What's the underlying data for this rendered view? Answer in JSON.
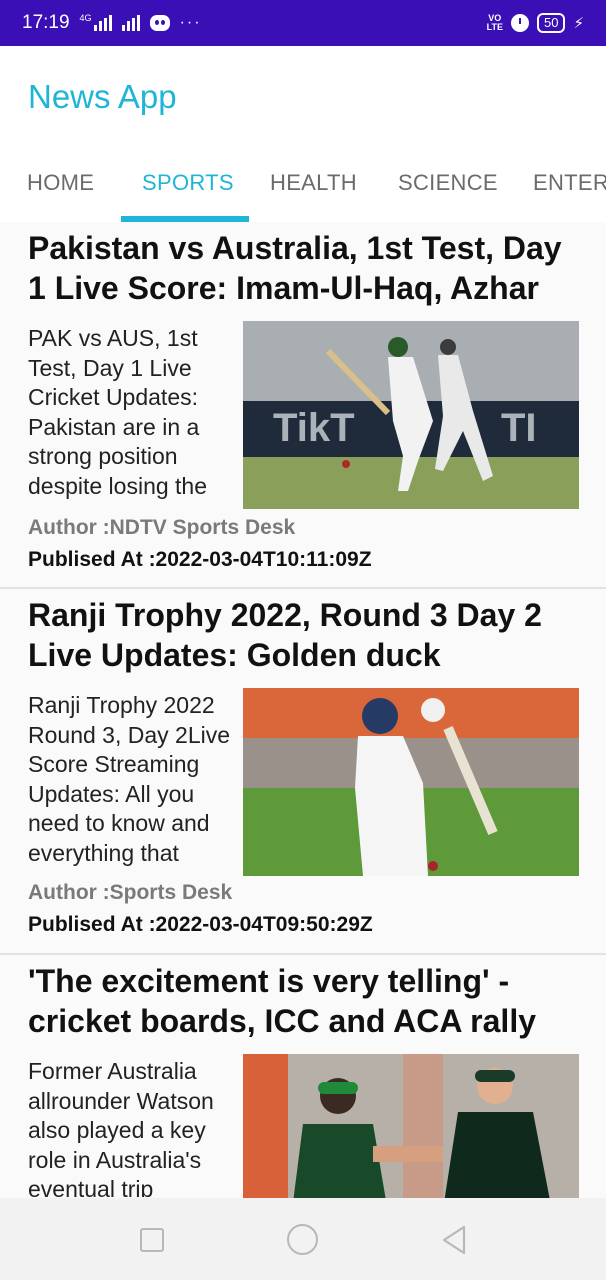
{
  "status_bar": {
    "time": "17:19",
    "network": "4G",
    "volte": "VO\nLTE",
    "battery": "50",
    "more": "···"
  },
  "app": {
    "title": "News App"
  },
  "tabs": [
    {
      "label": "HOME",
      "active": false
    },
    {
      "label": "SPORTS",
      "active": true
    },
    {
      "label": "HEALTH",
      "active": false
    },
    {
      "label": "SCIENCE",
      "active": false
    },
    {
      "label": "ENTERT",
      "active": false
    }
  ],
  "articles": [
    {
      "title": "Pakistan vs Australia, 1st Test, Day 1 Live Score: Imam-Ul-Haq, Azhar",
      "description": "PAK vs AUS, 1st Test, Day 1 Live Cricket Updates: Pakistan are in a strong position despite losing the wicket of",
      "author": "Author :NDTV Sports Desk",
      "published": "Publised At :2022-03-04T10:11:09Z",
      "image": "cricket-batsman-green-kit"
    },
    {
      "title": "Ranji Trophy 2022, Round 3 Day 2 Live Updates: Golden duck",
      "description": "Ranji Trophy 2022 Round 3, Day 2Live Score Streaming Updates: All you need to know and everything that",
      "author": "Author :Sports Desk",
      "published": "Publised At :2022-03-04T09:50:29Z",
      "image": "cricket-batsman-white-kit"
    },
    {
      "title": "'The excitement is very telling' - cricket boards, ICC and ACA rally",
      "description": "Former Australia allrounder Watson also played a key role in Australia's eventual trip",
      "image": "captains-fist-bump"
    }
  ],
  "colors": {
    "status_bar": "#3a0fb5",
    "accent": "#1fb5d6",
    "tab_inactive": "#6b6b6b"
  }
}
